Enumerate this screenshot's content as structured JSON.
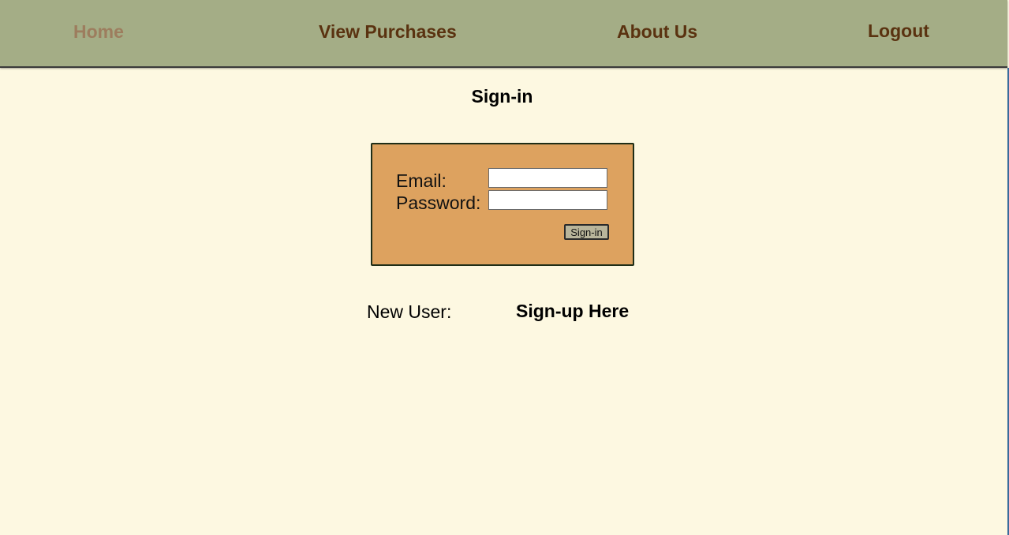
{
  "nav": {
    "items": [
      {
        "label": "Home",
        "active": true
      },
      {
        "label": "View Purchases",
        "active": false
      },
      {
        "label": "About Us",
        "active": false
      },
      {
        "label": "Logout",
        "active": false
      }
    ]
  },
  "main": {
    "title": "Sign-in",
    "form": {
      "email_label": "Email:",
      "email_value": "",
      "password_label": "Password:",
      "password_value": "",
      "submit_label": "Sign-in"
    },
    "new_user_label": "New User:",
    "signup_link": "Sign-up Here"
  },
  "colors": {
    "nav_background": "#a4ad86",
    "nav_text": "#5a3210",
    "nav_active_text": "#9d7d5e",
    "page_background": "#fdf8e1",
    "form_background": "#dda25f"
  }
}
